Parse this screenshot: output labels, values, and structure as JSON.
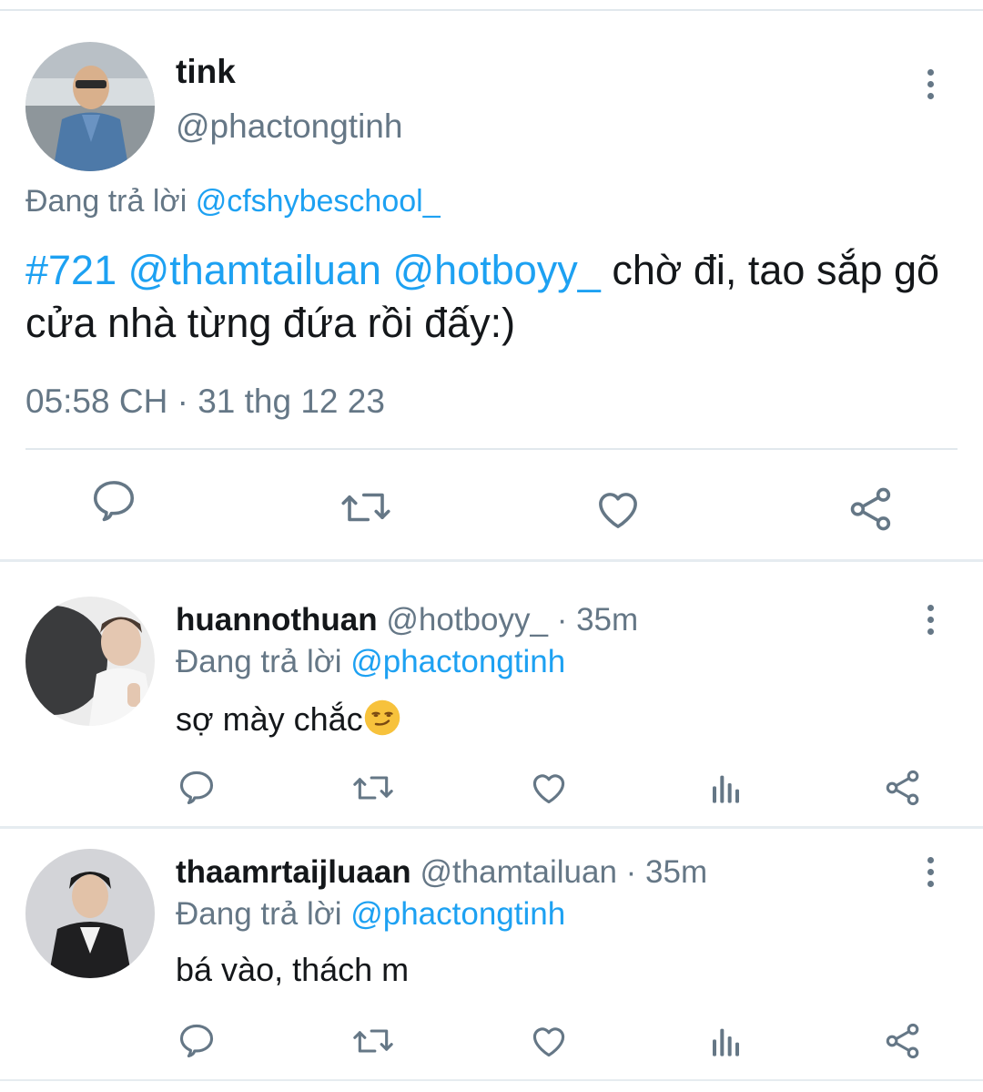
{
  "main_tweet": {
    "display_name": "tink",
    "handle": "@phactongtinh",
    "replying_prefix": "Đang trả lời",
    "replying_to": "@cfshybeschool_",
    "text_hashtag": "#721",
    "text_mention_1": "@thamtailuan",
    "text_mention_2": "@hotboyy_",
    "text_body": "chờ đi, tao sắp gõ cửa nhà từng đứa rồi đấy:)",
    "timestamp": "05:58 CH · 31 thg 12 23",
    "actions": [
      "reply-icon",
      "retweet-icon",
      "like-icon",
      "share-icon"
    ]
  },
  "replies": [
    {
      "display_name": "huannothuan",
      "handle": "@hotboyy_",
      "time": "· 35m",
      "replying_prefix": "Đang trả lời",
      "replying_to": "@phactongtinh",
      "text": "sợ mày chắc",
      "emoji": "smirking-face-emoji"
    },
    {
      "display_name": "thaamrtaijluaan",
      "handle": "@thamtailuan",
      "time": "· 35m",
      "replying_prefix": "Đang trả lời",
      "replying_to": "@phactongtinh",
      "text": "bá vào, thách m"
    }
  ],
  "colors": {
    "link": "#1da1f2",
    "secondary_text": "#657786",
    "primary_text": "#14171a",
    "divider": "#e1e8ed"
  }
}
